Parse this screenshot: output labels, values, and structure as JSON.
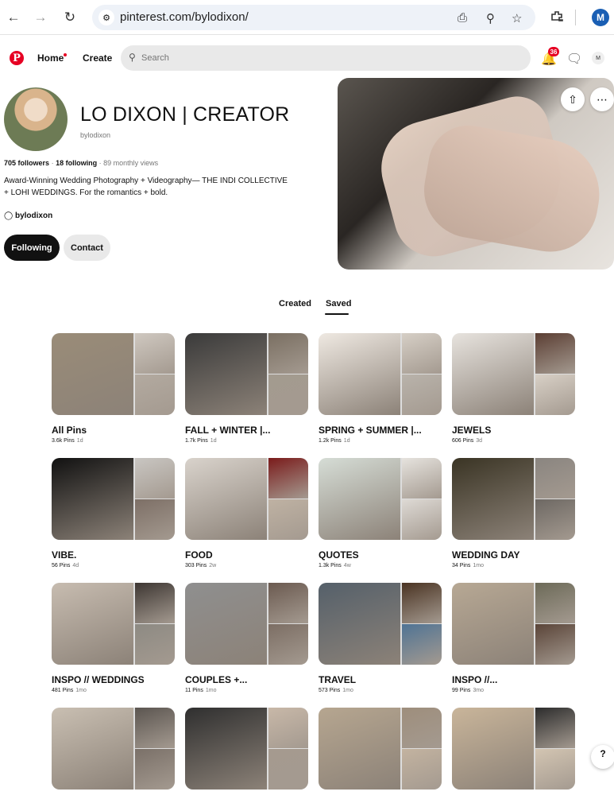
{
  "browser": {
    "url": "pinterest.com/bylodixon/",
    "profile_initial": "M",
    "icons": [
      "back-icon",
      "forward-icon",
      "reload-icon",
      "site-settings-icon",
      "install-icon",
      "zoom-icon",
      "bookmark-star-icon",
      "extensions-icon"
    ]
  },
  "header": {
    "logo": "P",
    "nav": {
      "home": "Home",
      "create": "Create"
    },
    "search_placeholder": "Search",
    "notification_count": "36",
    "avatar_initial": "M",
    "accent": "#e60023"
  },
  "profile": {
    "name": "LO DIXON | CREATOR",
    "username": "bylodixon",
    "followers_count": "705",
    "followers_label": "followers",
    "following_count": "18",
    "following_label": "following",
    "monthly_views": "· 89 monthly views",
    "bio_line1": "Award-Winning Wedding Photography + Videography— THE INDI COLLECTIVE",
    "bio_line2": "+ LOHI WEDDINGS. For the romantics + bold.",
    "instagram": "bylodixon",
    "following_button": "Following",
    "contact_button": "Contact"
  },
  "tabs": {
    "created": "Created",
    "saved": "Saved",
    "active": "saved"
  },
  "boards": [
    {
      "title": "All Pins",
      "pins": "3.6k Pins",
      "age": "1d",
      "colors": [
        "#9a8c78",
        "#cfc8c0",
        "#b3aaa0"
      ]
    },
    {
      "title": "FALL + WINTER |...",
      "pins": "1.7k Pins",
      "age": "1d",
      "colors": [
        "#3a3a3a",
        "#7a6f62",
        "#a39b8f"
      ]
    },
    {
      "title": "SPRING + SUMMER |...",
      "pins": "1.2k Pins",
      "age": "1d",
      "colors": [
        "#efe9e2",
        "#d6cfc6",
        "#b9b3ab"
      ]
    },
    {
      "title": "JEWELS",
      "pins": "606 Pins",
      "age": "3d",
      "colors": [
        "#e7e3de",
        "#5b3e33",
        "#d8d0c6"
      ]
    },
    {
      "title": "VIBE.",
      "pins": "56 Pins",
      "age": "4d",
      "colors": [
        "#111111",
        "#c9c6c2",
        "#7d6f66"
      ]
    },
    {
      "title": "FOOD",
      "pins": "303 Pins",
      "age": "2w",
      "colors": [
        "#d9d3cc",
        "#7a1b1b",
        "#bfb2a3"
      ]
    },
    {
      "title": "QUOTES",
      "pins": "1.3k Pins",
      "age": "4w",
      "colors": [
        "#d6ddd6",
        "#e6e3de",
        "#dedad5"
      ]
    },
    {
      "title": "WEDDING DAY",
      "pins": "34 Pins",
      "age": "1mo",
      "colors": [
        "#3a3424",
        "#8a8580",
        "#6d6863"
      ]
    },
    {
      "title": "INSPO // WEDDINGS",
      "pins": "481 Pins",
      "age": "1mo",
      "colors": [
        "#c7bcb0",
        "#3d3632",
        "#8d8a83"
      ]
    },
    {
      "title": "COUPLES +...",
      "pins": "11 Pins",
      "age": "1mo",
      "colors": [
        "#8f8f8f",
        "#6b5a50",
        "#7c6e64"
      ]
    },
    {
      "title": "TRAVEL",
      "pins": "573 Pins",
      "age": "1mo",
      "colors": [
        "#55606a",
        "#4a3322",
        "#4f7394"
      ]
    },
    {
      "title": "INSPO //...",
      "pins": "99 Pins",
      "age": "3mo",
      "colors": [
        "#b7a894",
        "#6c6a58",
        "#5a4438"
      ]
    },
    {
      "title": "",
      "pins": "",
      "age": "",
      "colors": [
        "#c9bfb2",
        "#5b5550",
        "#7a7068"
      ]
    },
    {
      "title": "",
      "pins": "",
      "age": "",
      "colors": [
        "#2f2f2f",
        "#c8b8a8",
        "#a59a8f"
      ]
    },
    {
      "title": "",
      "pins": "",
      "age": "",
      "colors": [
        "#b6a690",
        "#9e8e7c",
        "#c3b3a0"
      ]
    },
    {
      "title": "",
      "pins": "",
      "age": "",
      "colors": [
        "#c9b59a",
        "#2c2c2c",
        "#d3c5b2"
      ]
    }
  ]
}
